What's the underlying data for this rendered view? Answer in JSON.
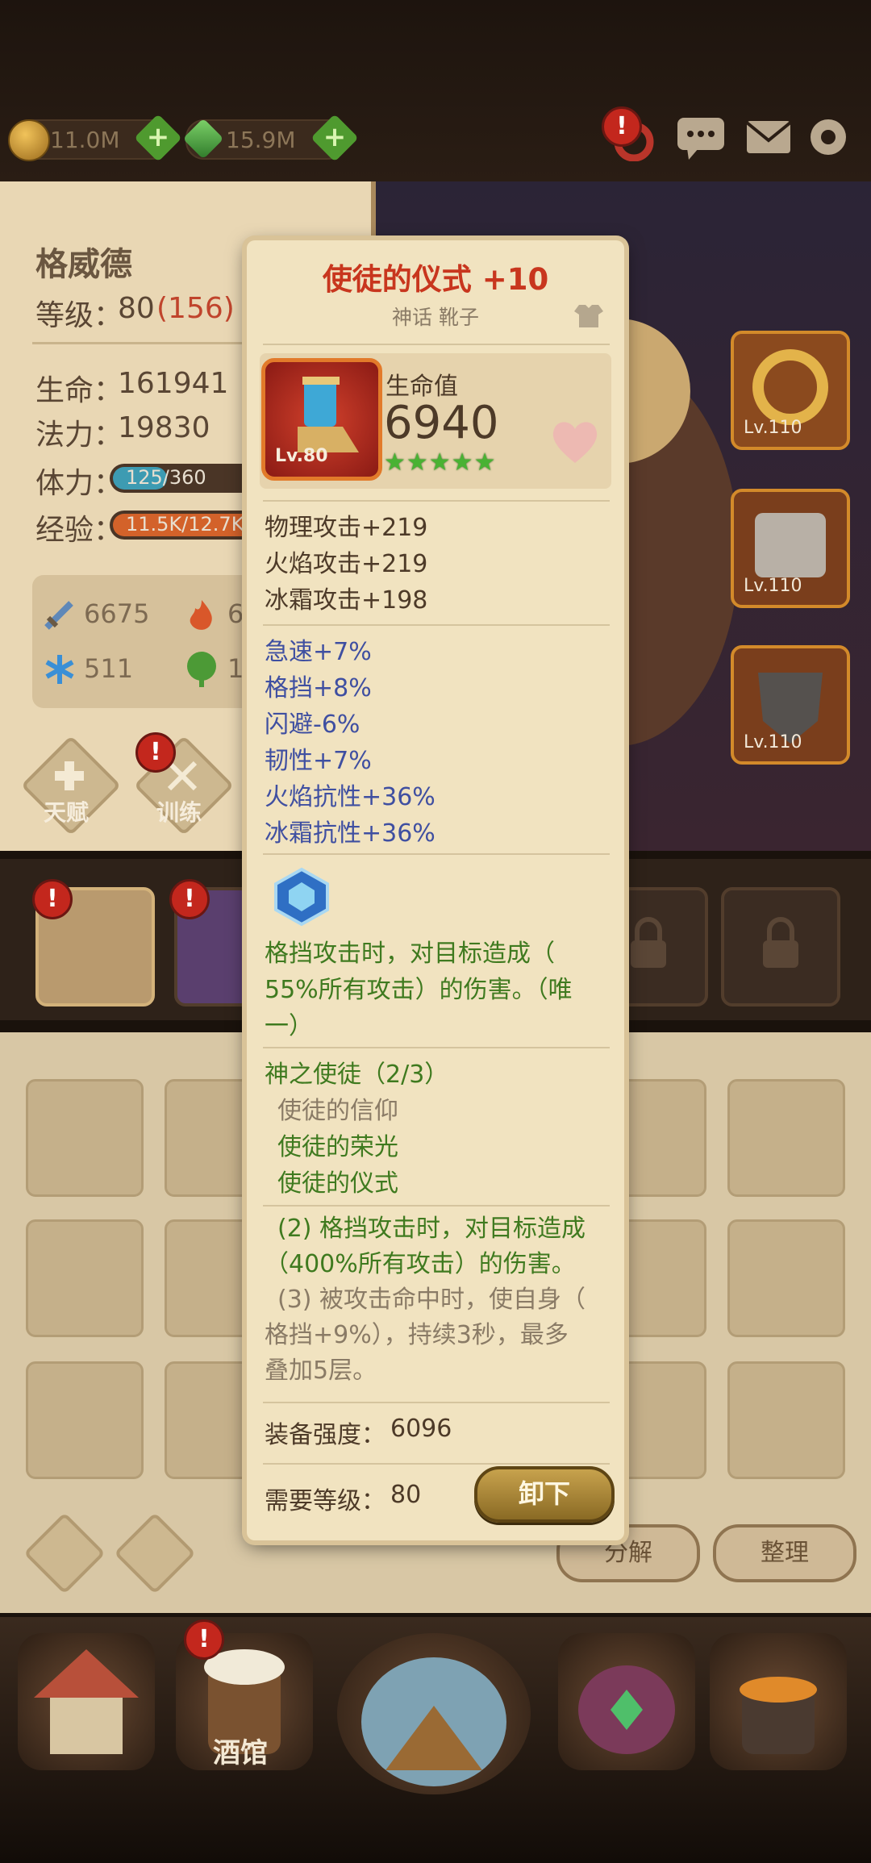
{
  "resources": [
    {
      "name": "gold",
      "value": "11.0M"
    },
    {
      "name": "gem",
      "value": "15.9M"
    }
  ],
  "top_icons": [
    {
      "name": "ring-icon",
      "alert": "!"
    },
    {
      "name": "chat-icon"
    },
    {
      "name": "mail-icon"
    },
    {
      "name": "settings-icon"
    }
  ],
  "hero": {
    "name": "格威德",
    "level_label": "等级：",
    "level": "80",
    "level_extra": "(156)",
    "hp_label": "生命：",
    "hp": "161941",
    "mp_label": "法力：",
    "mp": "19830",
    "stamina_label": "体力：",
    "stamina": "125/360",
    "stamina_fraction": 0.347,
    "exp_label": "经验：",
    "exp": "11.5K/12.7K",
    "exp_fraction": 0.906,
    "attack": "6675",
    "fire": "6",
    "ice": "511",
    "nature": "1",
    "talent_label": "天赋",
    "train_label": "训练",
    "train_alert": "!"
  },
  "slots": [
    {
      "label": "Lv.110"
    },
    {
      "label": "Lv.110"
    },
    {
      "label": "Lv.110"
    }
  ],
  "inventory": {
    "decompose_label": "分解",
    "sort_label": "整理"
  },
  "nav": {
    "tavern_label": "酒馆",
    "tavern_alert": "!"
  },
  "item": {
    "title": "使徒的仪式 +10",
    "rarity": "神话 靴子",
    "icon_level": "Lv.80",
    "main_stat_label": "生命值",
    "main_stat_value": "6940",
    "stars": "★★★★★",
    "stats_primary": [
      "物理攻击+219",
      "火焰攻击+219",
      "冰霜攻击+198"
    ],
    "stats_secondary": [
      "急速+7%",
      "格挡+8%",
      "闪避-6%",
      "韧性+7%",
      "火焰抗性+36%",
      "冰霜抗性+36%"
    ],
    "unique_effect_l1": "格挡攻击时，对目标造成（",
    "unique_effect_l2": "55%所有攻击）的伤害。（唯",
    "unique_effect_l3": "一）",
    "set_name": "神之使徒（2/3）",
    "set_pieces": [
      "使徒的信仰",
      "使徒的荣光",
      "使徒的仪式"
    ],
    "set_bonus2_l1": "(2) 格挡攻击时，对目标造成",
    "set_bonus2_l2": "（400%所有攻击）的伤害。",
    "set_bonus3_l1": "(3) 被攻击命中时，使自身（",
    "set_bonus3_l2": "格挡+9%），持续3秒，最多",
    "set_bonus3_l3": "叠加5层。",
    "power_label": "装备强度：",
    "power_value": "6096",
    "req_label": "需要等级：",
    "req_value": "80",
    "unequip_label": "卸下"
  },
  "colors": {
    "title_red": "#c8361e",
    "stat_brown": "#4d3a28",
    "stat_blue": "#3f4fa1",
    "effect_green": "#3f7a1f",
    "muted": "#8a7b66"
  }
}
